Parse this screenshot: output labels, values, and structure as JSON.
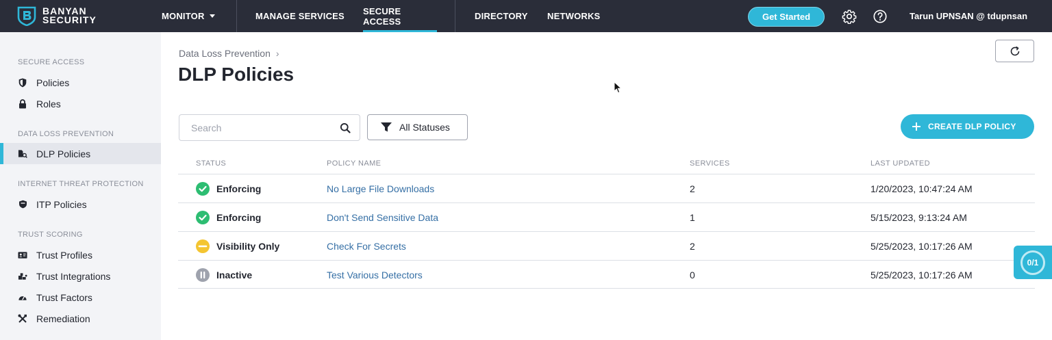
{
  "brand": {
    "line1": "BANYAN",
    "line2": "SECURITY"
  },
  "nav": {
    "monitor": "MONITOR",
    "manage_services": "MANAGE SERVICES",
    "secure_access": "SECURE ACCESS",
    "directory": "DIRECTORY",
    "networks": "NETWORKS",
    "active": "SECURE ACCESS"
  },
  "header": {
    "get_started": "Get Started",
    "user": "Tarun UPNSAN @ tdupnsan",
    "icons": [
      "gear-icon",
      "help-icon"
    ]
  },
  "sidebar": {
    "sections": [
      {
        "title": "SECURE ACCESS",
        "items": [
          {
            "label": "Policies",
            "icon": "shield-icon"
          },
          {
            "label": "Roles",
            "icon": "lock-icon"
          }
        ]
      },
      {
        "title": "DATA LOSS PREVENTION",
        "items": [
          {
            "label": "DLP Policies",
            "icon": "dlp-icon",
            "active": true
          }
        ]
      },
      {
        "title": "INTERNET THREAT PROTECTION",
        "items": [
          {
            "label": "ITP Policies",
            "icon": "itp-shield-icon"
          }
        ]
      },
      {
        "title": "TRUST SCORING",
        "items": [
          {
            "label": "Trust Profiles",
            "icon": "id-card-icon"
          },
          {
            "label": "Trust Integrations",
            "icon": "integration-icon"
          },
          {
            "label": "Trust Factors",
            "icon": "gauge-icon"
          },
          {
            "label": "Remediation",
            "icon": "tools-icon"
          }
        ]
      }
    ]
  },
  "page": {
    "breadcrumb": "Data Loss Prevention",
    "title": "DLP Policies"
  },
  "toolbar": {
    "search_placeholder": "Search",
    "search_value": "",
    "status_filter": "All Statuses",
    "create_label": "CREATE DLP POLICY"
  },
  "table": {
    "columns": [
      "STATUS",
      "POLICY NAME",
      "SERVICES",
      "LAST UPDATED"
    ],
    "rows": [
      {
        "status": "Enforcing",
        "status_kind": "enforcing",
        "name": "No Large File Downloads",
        "services": "2",
        "updated": "1/20/2023, 10:47:24 AM"
      },
      {
        "status": "Enforcing",
        "status_kind": "enforcing",
        "name": "Don't Send Sensitive Data",
        "services": "1",
        "updated": "5/15/2023, 9:13:24 AM"
      },
      {
        "status": "Visibility Only",
        "status_kind": "visibility",
        "name": "Check For Secrets",
        "services": "2",
        "updated": "5/25/2023, 10:17:26 AM"
      },
      {
        "status": "Inactive",
        "status_kind": "inactive",
        "name": "Test Various Detectors",
        "services": "0",
        "updated": "5/25/2023, 10:17:26 AM"
      }
    ]
  },
  "widget": {
    "progress": "0/1"
  },
  "colors": {
    "accent": "#2fb7d8",
    "topbar": "#2a2d39",
    "enforcing": "#2dbd72",
    "visibility": "#f4c531",
    "inactive": "#9ea2ad",
    "link": "#356fa5"
  }
}
